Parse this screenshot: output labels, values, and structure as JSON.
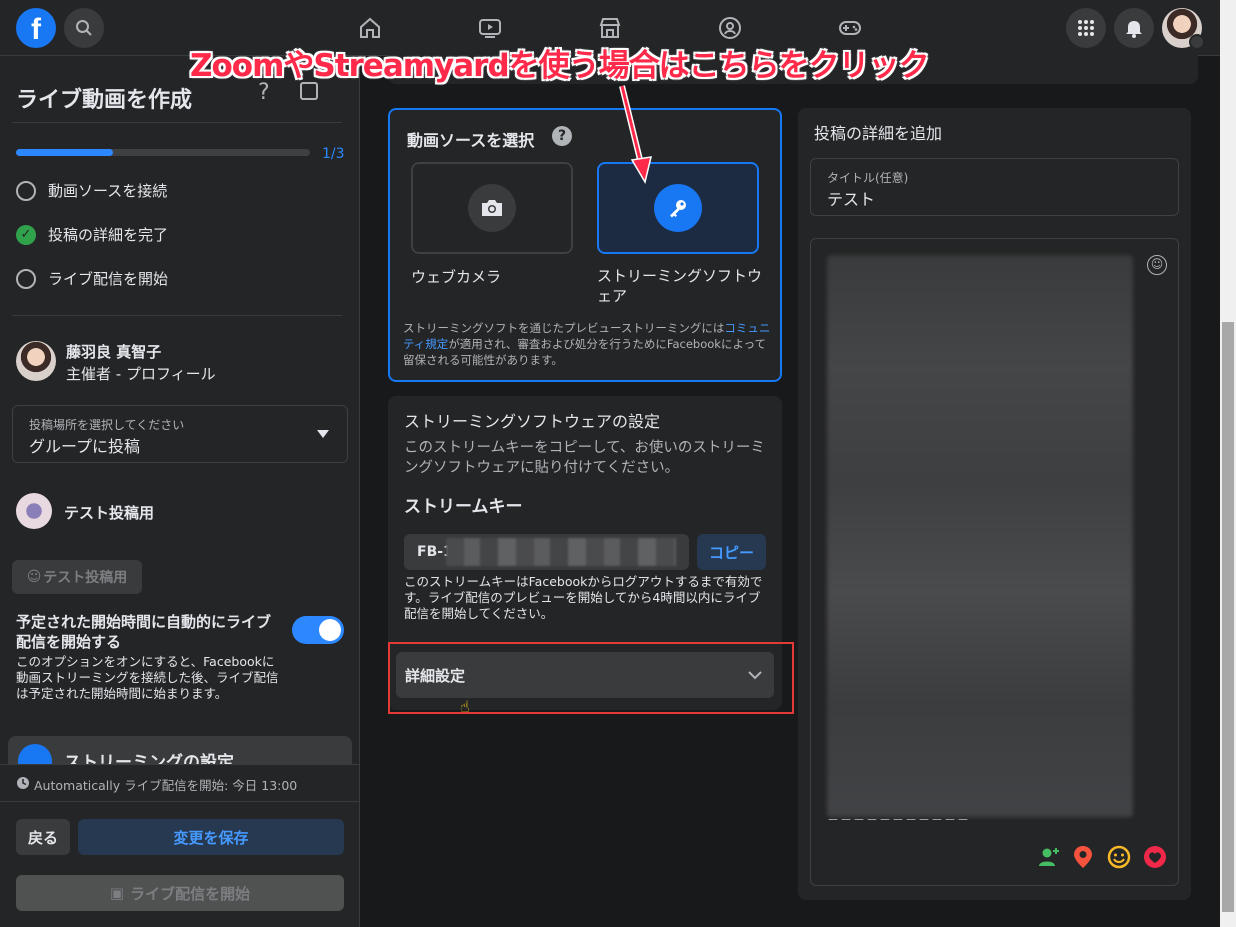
{
  "annotation": {
    "text": "ZoomやStreamyardを使う場合はこちらをクリック",
    "color": "#ff2a4a"
  },
  "topbar": {
    "icons": [
      "facebook-logo",
      "search-icon",
      "home-icon",
      "watch-icon",
      "marketplace-icon",
      "groups-icon",
      "gaming-icon",
      "menu-grid-icon",
      "bell-icon",
      "profile-avatar"
    ]
  },
  "sidebar": {
    "title": "ライブ動画を作成",
    "progress_label": "1/3",
    "progress_fraction": 0.33,
    "steps": [
      {
        "label": "動画ソースを接続",
        "done": false
      },
      {
        "label": "投稿の詳細を完了",
        "done": true
      },
      {
        "label": "ライブ配信を開始",
        "done": false
      }
    ],
    "host": {
      "name": "藤羽良 真智子",
      "role": "主催者 - プロフィール"
    },
    "post_location": {
      "label": "投稿場所を選択してください",
      "value": "グループに投稿"
    },
    "group_name": "テスト投稿用",
    "group_button": "テスト投稿用",
    "auto_start": {
      "title": "予定された開始時間に自動的にライブ配信を開始する",
      "desc": "このオプションをオンにすると、Facebookに動画ストリーミングを接続した後、ライブ配信は予定された開始時間に始まります。",
      "enabled": true
    },
    "streaming_settings_label": "ストリーミングの設定",
    "schedule_text": "Automatically ライブ配信を開始: 今日 13:00",
    "back_button": "戻る",
    "save_button": "変更を保存",
    "go_live_button": "ライブ配信を開始"
  },
  "video_source": {
    "title": "動画ソースを選択",
    "webcam_label": "ウェブカメラ",
    "streaming_label": "ストリーミングソフトウェア",
    "notice_prefix": "ストリーミングソフトを通じたプレビューストリーミングには",
    "notice_link": "コミュニティ規定",
    "notice_suffix": "が適用され、審査および処分を行うためにFacebookによって留保される可能性があります。",
    "accent": "#1877f2"
  },
  "streaming_settings": {
    "title": "ストリーミングソフトウェアの設定",
    "desc": "このストリームキーをコピーして、お使いのストリーミングソフトウェアに貼り付けてください。",
    "key_heading": "ストリームキー",
    "key_prefix": "FB-1",
    "copy_button": "コピー",
    "key_note": "このストリームキーはFacebookからログアウトするまで有効です。ライブ配信のプレビューを開始してから4時間以内にライブ配信を開始してください。",
    "advanced": "詳細設定"
  },
  "post_details": {
    "title": "投稿の詳細を追加",
    "title_field_label": "タイトル(任意)",
    "title_field_value": "テスト",
    "dashes": "－－－－－－－－－－－"
  }
}
